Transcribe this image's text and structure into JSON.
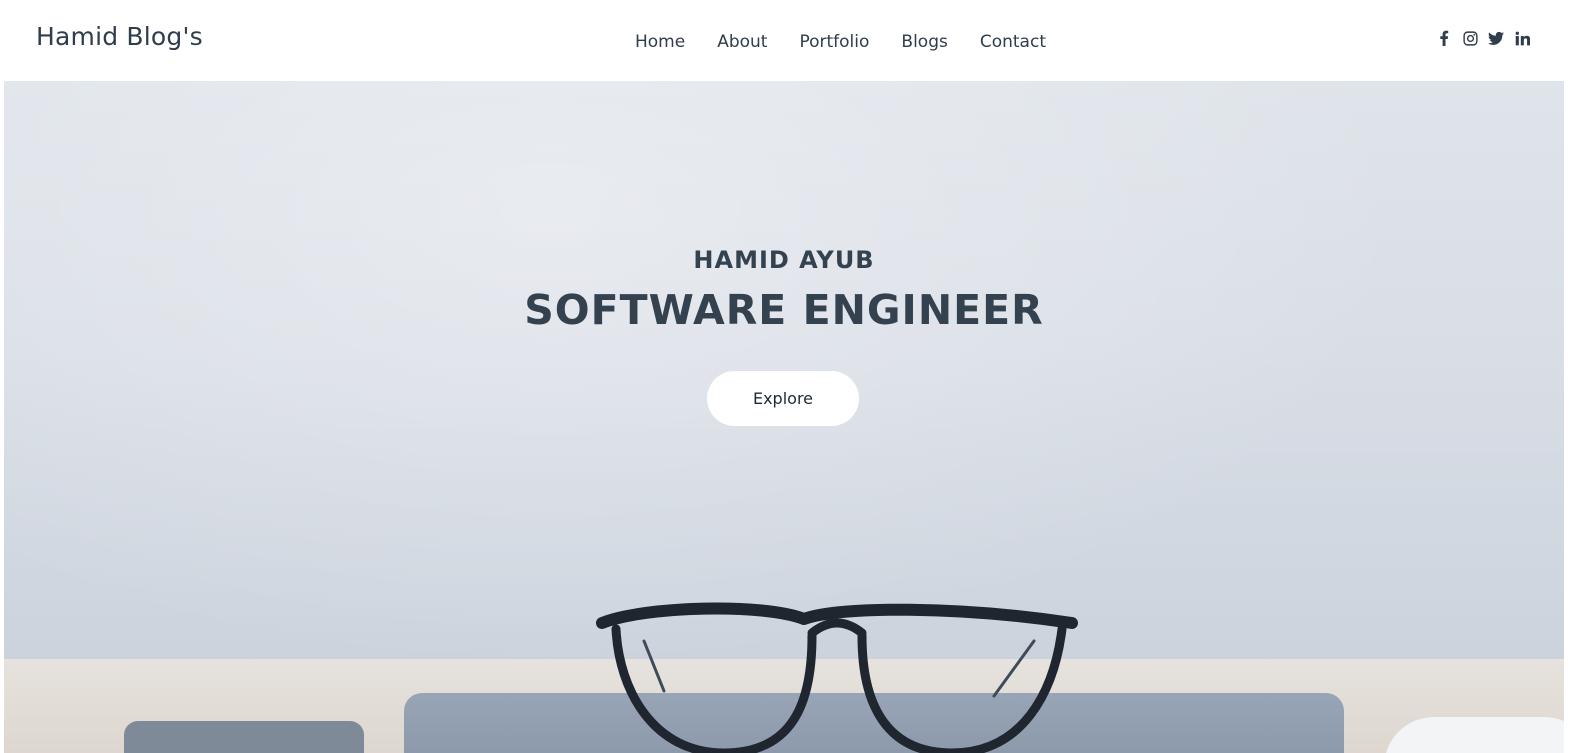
{
  "navbar": {
    "brand": "Hamid Blog's",
    "links": [
      {
        "label": "Home"
      },
      {
        "label": "About"
      },
      {
        "label": "Portfolio"
      },
      {
        "label": "Blogs"
      },
      {
        "label": "Contact"
      }
    ],
    "socials": [
      {
        "icon": "facebook-icon"
      },
      {
        "icon": "instagram-icon"
      },
      {
        "icon": "twitter-icon"
      },
      {
        "icon": "linkedin-icon"
      }
    ]
  },
  "hero": {
    "name": "HAMID AYUB",
    "title": "SOFTWARE ENGINEER",
    "cta_label": "Explore",
    "background_image": "glasses-on-laptop-desk"
  },
  "colors": {
    "text": "#2f3d4c",
    "button_bg": "#ffffff"
  }
}
